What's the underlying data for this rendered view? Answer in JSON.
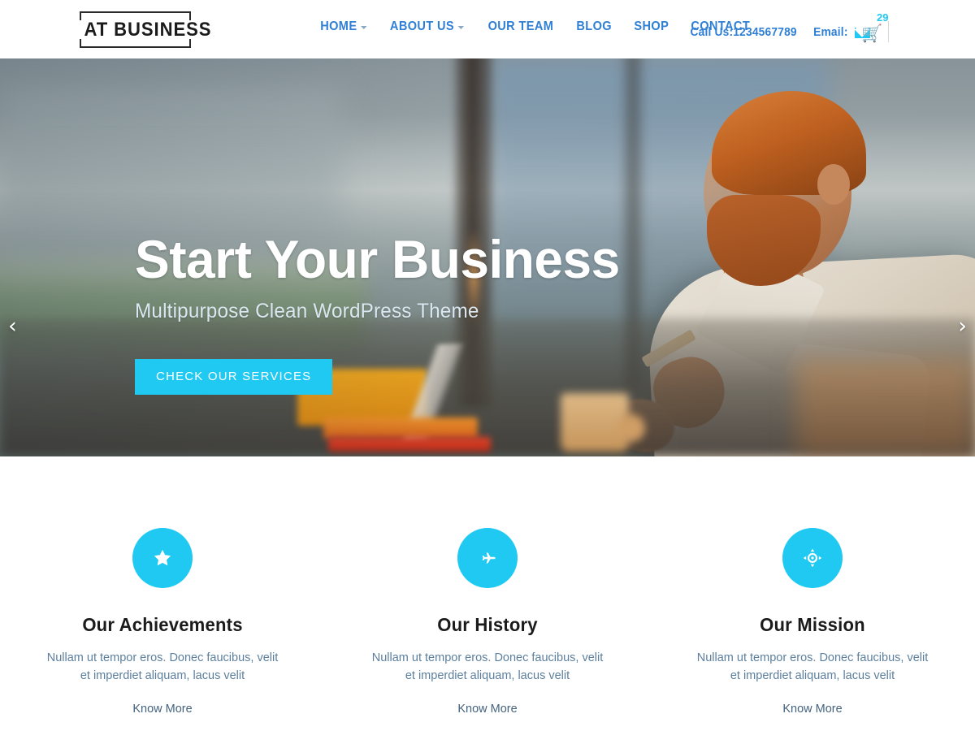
{
  "brand": {
    "logo_text": "AT  BUSINESS",
    "accent_color": "#1fc9f2",
    "link_color": "#2f7fd4"
  },
  "header": {
    "nav": [
      {
        "label": "HOME",
        "has_dropdown": true
      },
      {
        "label": "ABOUT US",
        "has_dropdown": true
      },
      {
        "label": "OUR TEAM",
        "has_dropdown": false
      },
      {
        "label": "BLOG",
        "has_dropdown": false
      },
      {
        "label": "SHOP",
        "has_dropdown": false
      },
      {
        "label": "CONTACT",
        "has_dropdown": false
      }
    ],
    "phone_label": "Call Us:1234567789",
    "email_label": "Email:",
    "email_icon": "envelope-icon",
    "cart_icon": "shopping-cart-icon",
    "cart_count": "29"
  },
  "hero": {
    "title": "Start Your Business",
    "subtitle": "Multipurpose Clean WordPress Theme",
    "cta_label": "CHECK OUR SERVICES",
    "prev_icon": "chevron-left-icon",
    "next_icon": "chevron-right-icon",
    "prev_glyph": "‹",
    "next_glyph": "›",
    "slides": [
      {
        "active": true
      },
      {
        "active": false
      },
      {
        "active": false
      }
    ]
  },
  "features": [
    {
      "icon": "star-icon",
      "title": "Our Achievements",
      "desc": "Nullam ut tempor eros. Donec faucibus, velit et imperdiet aliquam, lacus velit",
      "link": "Know More"
    },
    {
      "icon": "airplane-icon",
      "title": "Our History",
      "desc": "Nullam ut tempor eros. Donec faucibus, velit et imperdiet aliquam, lacus velit",
      "link": "Know More"
    },
    {
      "icon": "crosshair-icon",
      "title": "Our Mission",
      "desc": "Nullam ut tempor eros. Donec faucibus, velit et imperdiet aliquam, lacus velit",
      "link": "Know More"
    }
  ]
}
